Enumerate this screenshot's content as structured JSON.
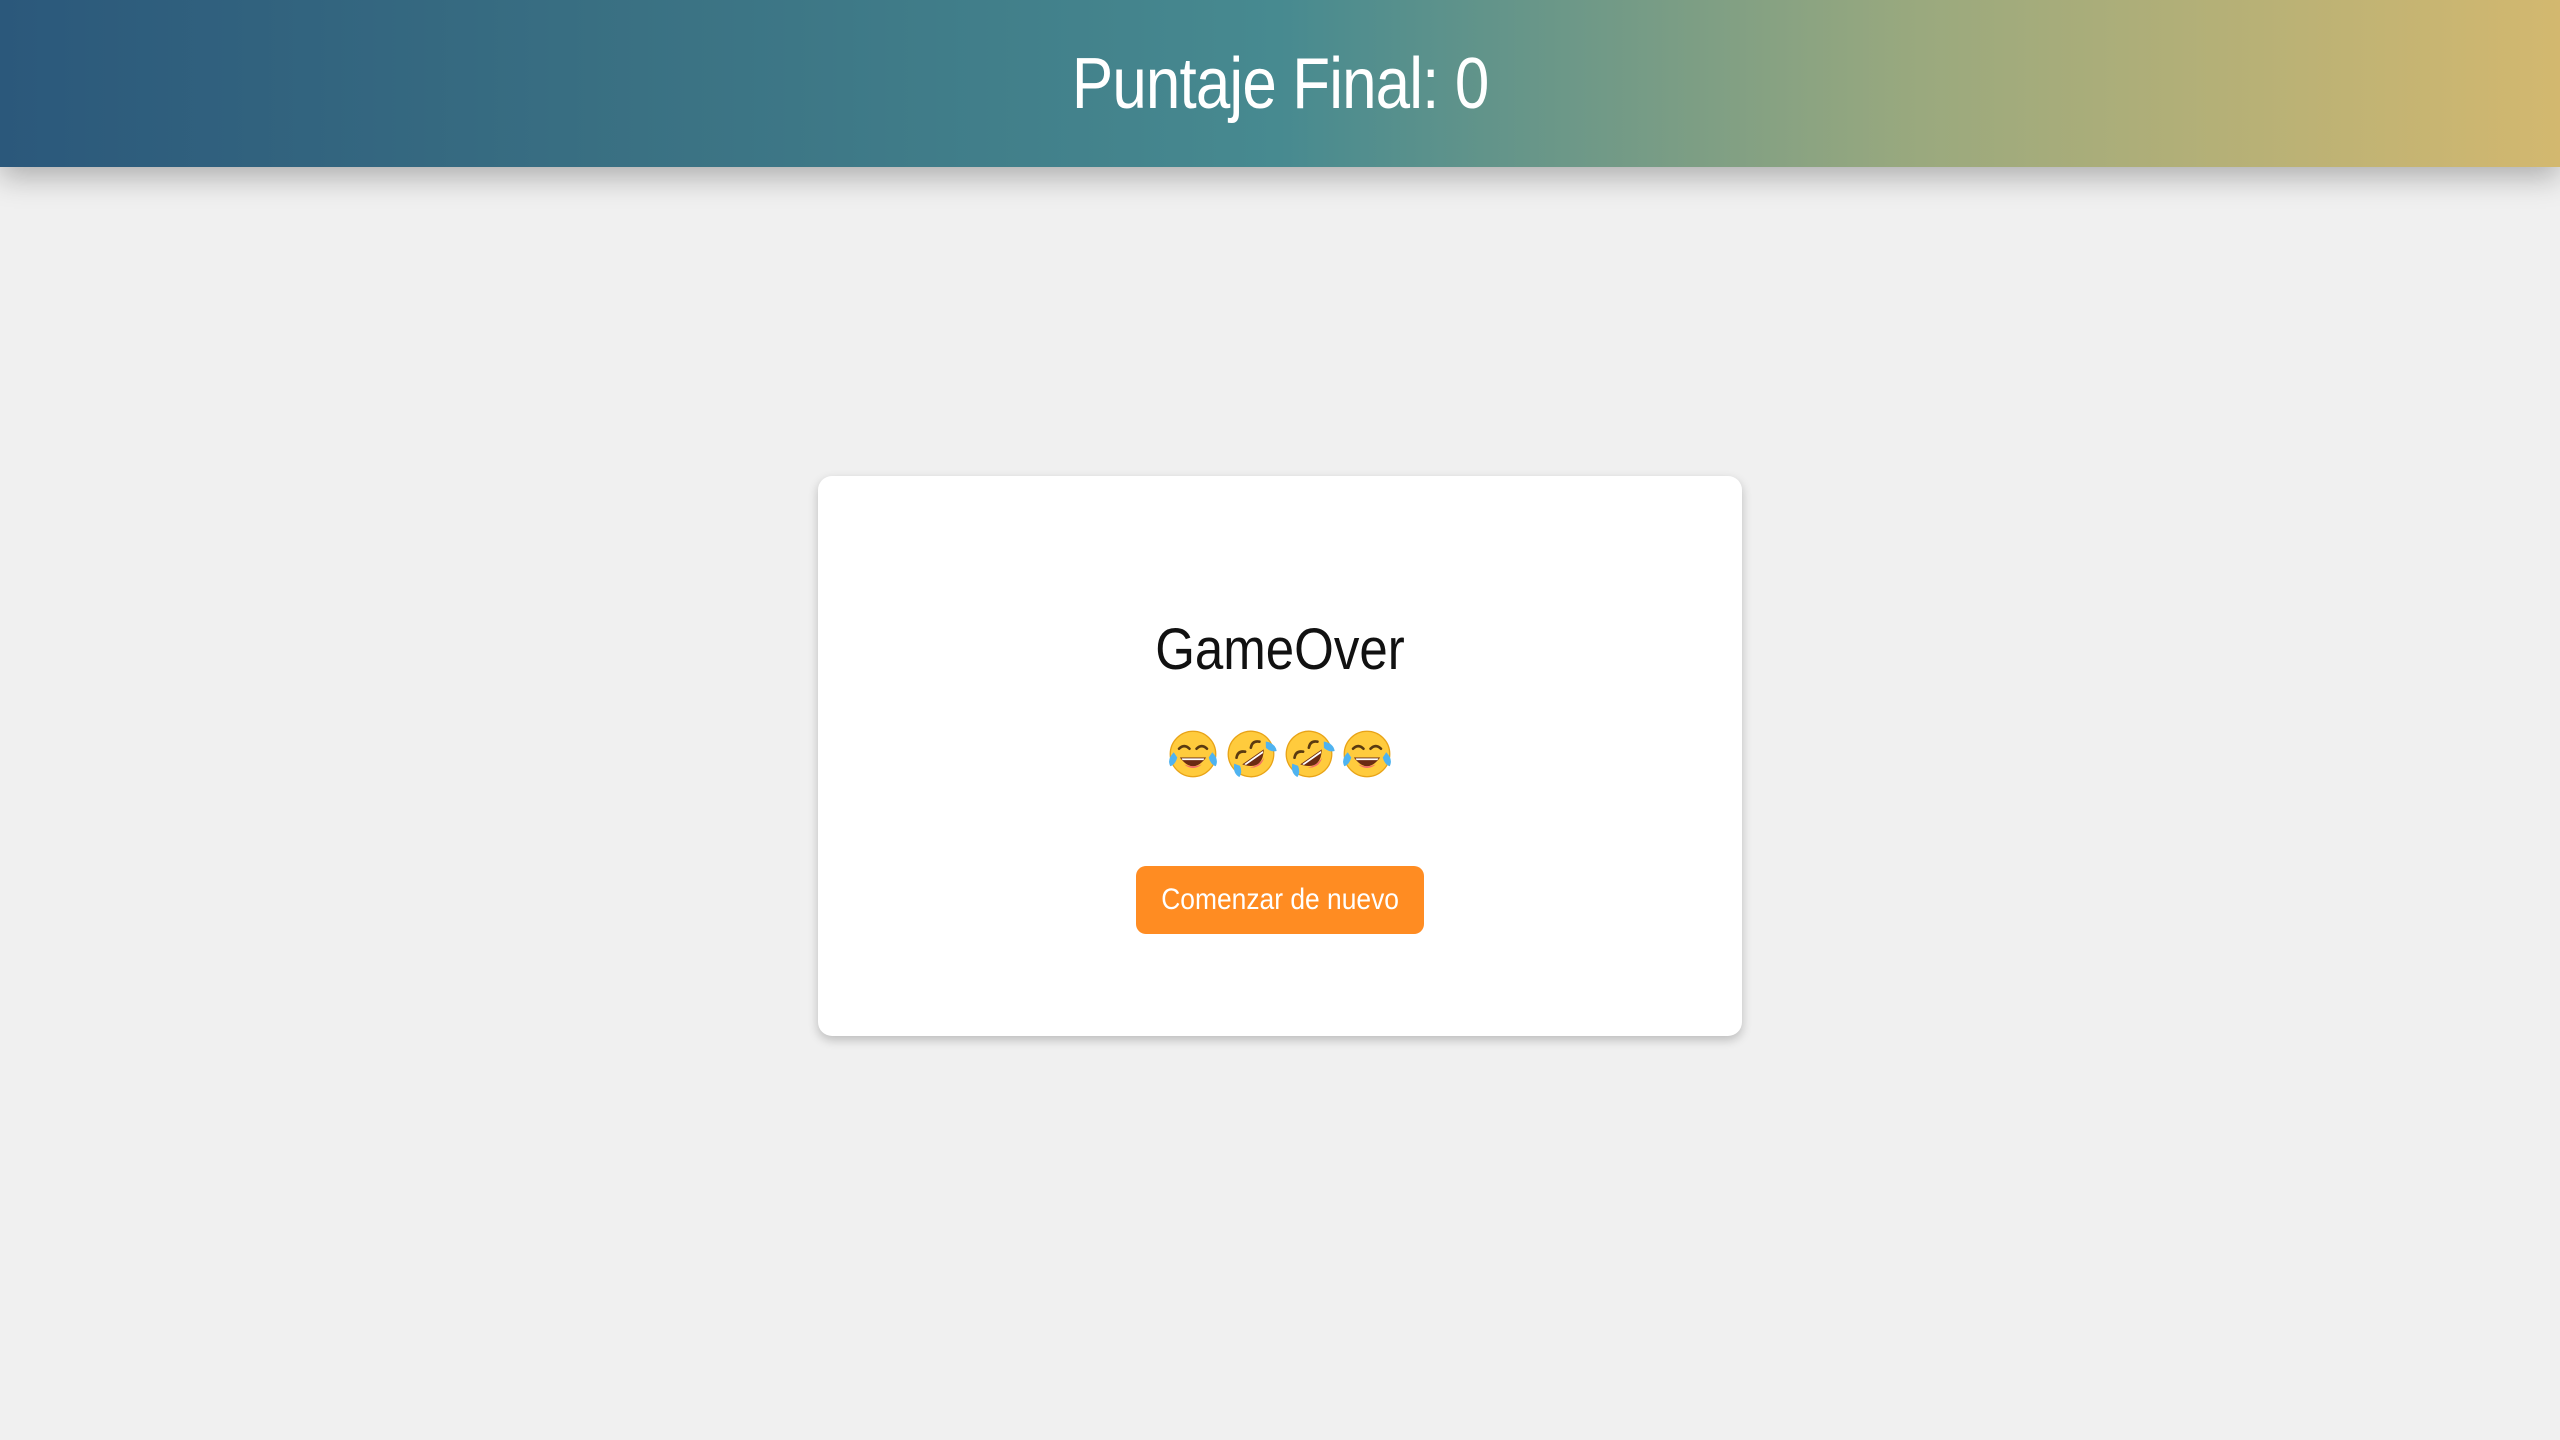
{
  "header": {
    "title": "Puntaje Final: 0"
  },
  "card": {
    "heading": "GameOver",
    "emojis": [
      {
        "icon": "face-with-tears-of-joy-icon",
        "char": "😂"
      },
      {
        "icon": "rolling-on-the-floor-laughing-icon",
        "char": "🤣"
      },
      {
        "icon": "rolling-on-the-floor-laughing-icon",
        "char": "🤣"
      },
      {
        "icon": "face-with-tears-of-joy-icon",
        "char": "😂"
      }
    ],
    "restart_label": "Comenzar de nuevo"
  },
  "colors": {
    "header_gradient_start": "#2b587b",
    "header_gradient_end": "#d3b86f",
    "button": "#ff8c22",
    "background": "#f0f0f0"
  }
}
